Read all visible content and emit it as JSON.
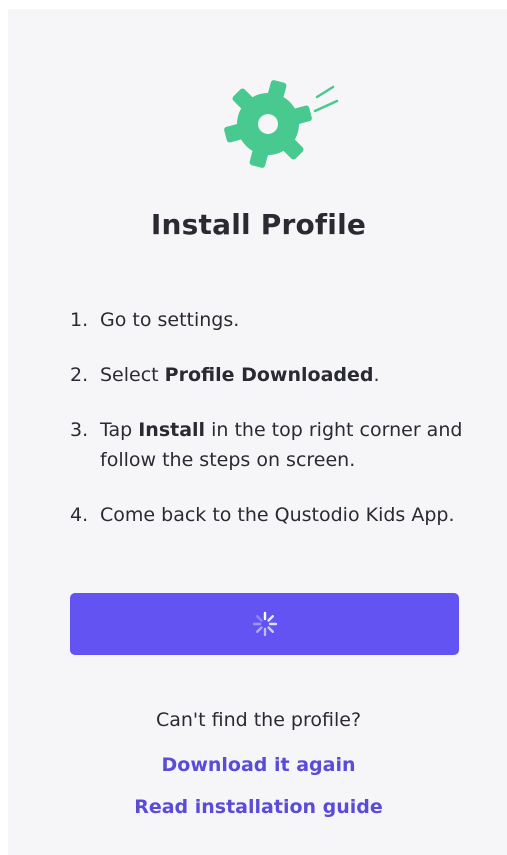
{
  "icons": {
    "header": "gear-icon",
    "loading": "spinner-icon"
  },
  "colors": {
    "accent": "#6253f2",
    "gear": "#48c98f",
    "link": "#5a4bd8"
  },
  "title": "Install Profile",
  "steps": [
    {
      "number": "1.",
      "pre": "Go to settings.",
      "bold": "",
      "post": ""
    },
    {
      "number": "2.",
      "pre": "Select ",
      "bold": "Profile Downloaded",
      "post": "."
    },
    {
      "number": "3.",
      "pre": "Tap ",
      "bold": "Install",
      "post": " in the top right corner and follow the steps on screen."
    },
    {
      "number": "4.",
      "pre": "Come back to the Qustodio Kids App.",
      "bold": "",
      "post": ""
    }
  ],
  "help": {
    "question": "Can't find the profile?",
    "download_again": "Download it again",
    "read_guide": "Read installation guide"
  }
}
